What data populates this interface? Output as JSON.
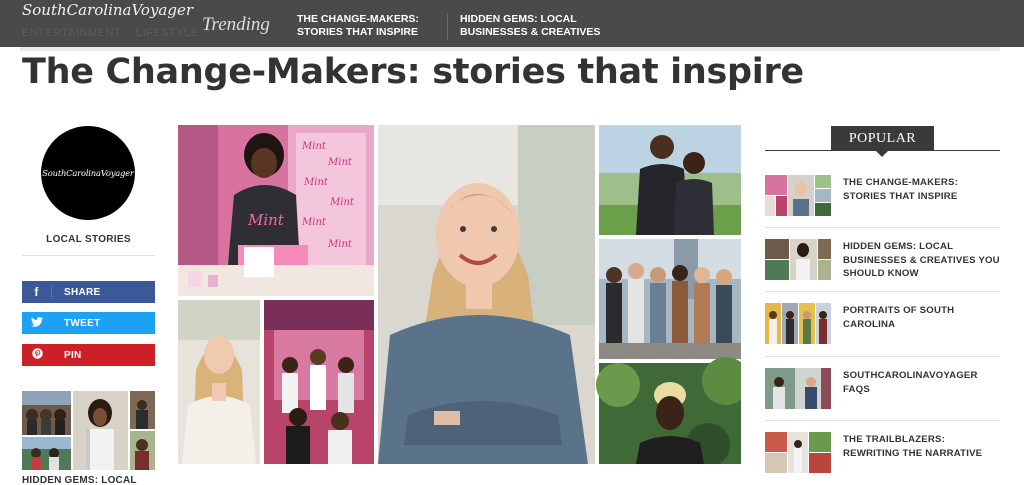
{
  "header": {
    "brand": "SouthCarolinaVoyager",
    "trending_label": "Trending",
    "trending_links": [
      "THE CHANGE-MAKERS: STORIES THAT INSPIRE",
      "HIDDEN GEMS: LOCAL BUSINESSES & CREATIVES"
    ],
    "nav_ghost": [
      "ENTERTAINMENT",
      "LIFESTYLE"
    ]
  },
  "page": {
    "title": "The Change-Makers: stories that inspire"
  },
  "left_column": {
    "logo_text": "SouthCarolinaVoyager",
    "section_label": "LOCAL STORIES",
    "share_buttons": [
      {
        "icon": "facebook-icon",
        "label": "SHARE",
        "color": "#3b5998"
      },
      {
        "icon": "twitter-icon",
        "label": "TWEET",
        "color": "#1da1f2"
      },
      {
        "icon": "pinterest-icon",
        "label": "PIN",
        "color": "#cb2027"
      }
    ],
    "related_caption": "HIDDEN GEMS: LOCAL"
  },
  "popular": {
    "heading": "POPULAR",
    "items": [
      {
        "title": "THE CHANGE-MAKERS: STORIES THAT INSPIRE"
      },
      {
        "title": "HIDDEN GEMS: LOCAL BUSINESSES & CREATIVES YOU SHOULD KNOW"
      },
      {
        "title": "PORTRAITS OF SOUTH CAROLINA"
      },
      {
        "title": "SOUTHCAROLINAVOYAGER FAQS"
      },
      {
        "title": "THE TRAILBLAZERS: REWRITING THE NARRATIVE"
      }
    ]
  },
  "colors": {
    "topbar": "#4a4a4a",
    "title_text": "#333333",
    "facebook": "#3b5998",
    "twitter": "#1da1f2",
    "pinterest": "#cb2027"
  }
}
